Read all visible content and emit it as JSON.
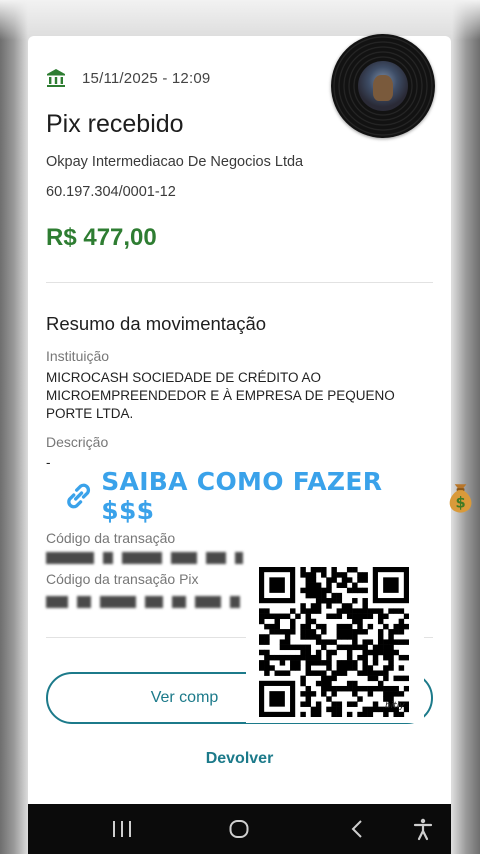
{
  "receipt": {
    "date": "15/11/2025 - 12:09",
    "title": "Pix recebido",
    "payer_name": "Okpay Intermediacao De Negocios Ltda",
    "payer_cnpj": "60.197.304/0001-12",
    "amount": "R$ 477,00"
  },
  "summary": {
    "title": "Resumo da movimentação",
    "institution_label": "Instituição",
    "institution_value": "MICROCASH SOCIEDADE DE CRÉDITO AO MICROEMPREENDEDOR E À EMPRESA DE PEQUENO PORTE LTDA.",
    "description_label": "Descrição",
    "description_value": "-",
    "transaction_code_label": "Código da transação",
    "pix_code_label": "Código da transação Pix"
  },
  "actions": {
    "view_receipt_label": "Ver comp",
    "refund_label": "Devolver"
  },
  "overlay": {
    "promo_text": "SAIBA COMO FAZER $$$",
    "qr_brand": "bitly"
  },
  "colors": {
    "amount_green": "#2e7d32",
    "accent_teal": "#1c7a8a",
    "promo_blue": "#3aa2ea"
  },
  "icons": {
    "bank": "bank-icon",
    "link": "link-icon",
    "money_bag": "money-bag-icon",
    "nav_recents": "recents-icon",
    "nav_home": "home-icon",
    "nav_back": "back-icon",
    "nav_accessibility": "accessibility-icon"
  }
}
